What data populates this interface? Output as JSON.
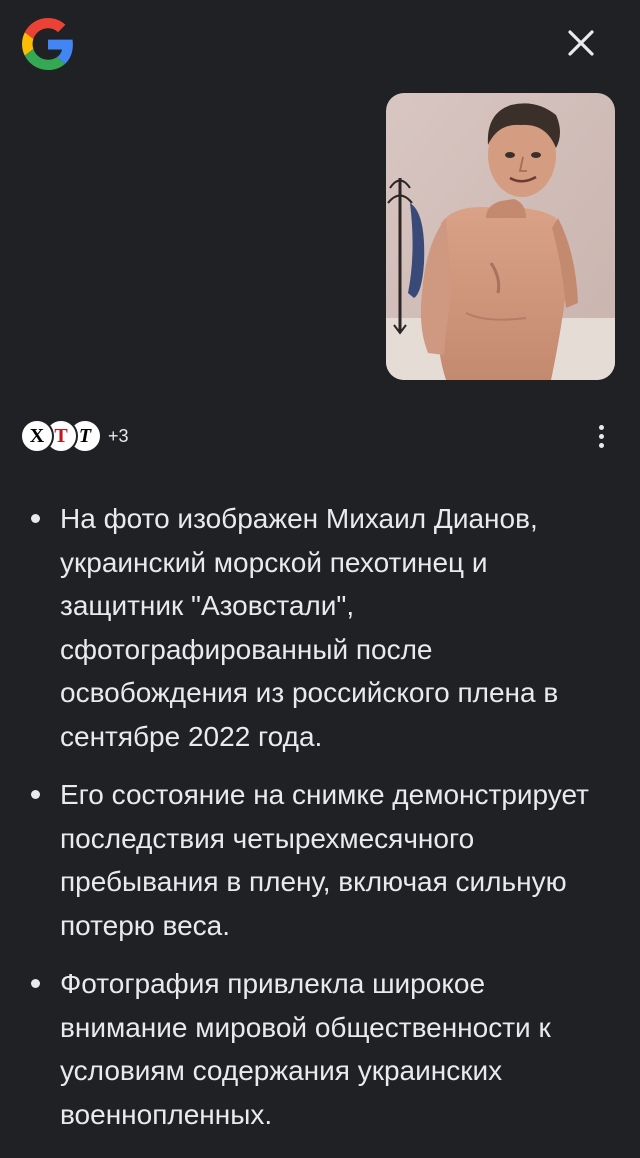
{
  "header": {
    "logo_icon": "google-g-logo",
    "close_icon": "close-icon"
  },
  "image": {
    "subject": "person-photo"
  },
  "sources": {
    "icons": [
      "x-logo",
      "t-logo",
      "nyt-logo"
    ],
    "x_letter": "X",
    "t_letter": "T",
    "nyt_letter": "T",
    "more_count": "+3"
  },
  "colors": {
    "background": "#202124",
    "text": "#e8eaed"
  },
  "bullets": [
    "На фото изображен Михаил Дианов, украинский морской пехотинец и защитник \"Азовстали\", сфотографированный после освобождения из российского плена в сентябре 2022 года.",
    "Его состояние на снимке демонстрирует последствия четырехмесячного пребывания в плену, включая сильную потерю веса.",
    "Фотография привлекла широкое внимание мировой общественности к условиям содержания украинских военнопленных."
  ]
}
